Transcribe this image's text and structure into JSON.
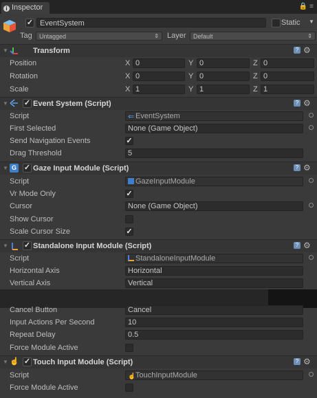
{
  "tab": {
    "title": "Inspector"
  },
  "object": {
    "active": true,
    "name": "EventSystem",
    "static_label": "Static",
    "tag_label": "Tag",
    "tag_value": "Untagged",
    "layer_label": "Layer",
    "layer_value": "Default"
  },
  "transform": {
    "title": "Transform",
    "rows": [
      {
        "label": "Position",
        "x": "0",
        "y": "0",
        "z": "0"
      },
      {
        "label": "Rotation",
        "x": "0",
        "y": "0",
        "z": "0"
      },
      {
        "label": "Scale",
        "x": "1",
        "y": "1",
        "z": "1"
      }
    ],
    "axes": [
      "X",
      "Y",
      "Z"
    ]
  },
  "event_system": {
    "title": "Event System (Script)",
    "script_label": "Script",
    "script_value": "EventSystem",
    "first_selected_label": "First Selected",
    "first_selected_value": "None (Game Object)",
    "send_nav_label": "Send Navigation Events",
    "send_nav_checked": true,
    "drag_label": "Drag Threshold",
    "drag_value": "5"
  },
  "gaze": {
    "title": "Gaze Input Module (Script)",
    "script_label": "Script",
    "script_value": "GazeInputModule",
    "vr_label": "Vr Mode Only",
    "vr_checked": true,
    "cursor_label": "Cursor",
    "cursor_value": "None (Game Object)",
    "show_cursor_label": "Show Cursor",
    "show_cursor_checked": false,
    "scale_label": "Scale Cursor Size",
    "scale_checked": true
  },
  "standalone": {
    "title": "Standalone Input Module (Script)",
    "script_label": "Script",
    "script_value": "StandaloneInputModule",
    "h_label": "Horizontal Axis",
    "h_value": "Horizontal",
    "v_label": "Vertical Axis",
    "v_value": "Vertical",
    "cancel_label": "Cancel Button",
    "cancel_value": "Cancel",
    "iaps_label": "Input Actions Per Second",
    "iaps_value": "10",
    "repeat_label": "Repeat Delay",
    "repeat_value": "0.5",
    "force_label": "Force Module Active",
    "force_checked": false
  },
  "touch": {
    "title": "Touch Input Module (Script)",
    "script_label": "Script",
    "script_value": "TouchInputModule",
    "force_label": "Force Module Active",
    "force_checked": false
  },
  "colors": {
    "bg": "#3a3a3a",
    "field": "#2c2c2c",
    "accent": "#6d8fb5"
  }
}
